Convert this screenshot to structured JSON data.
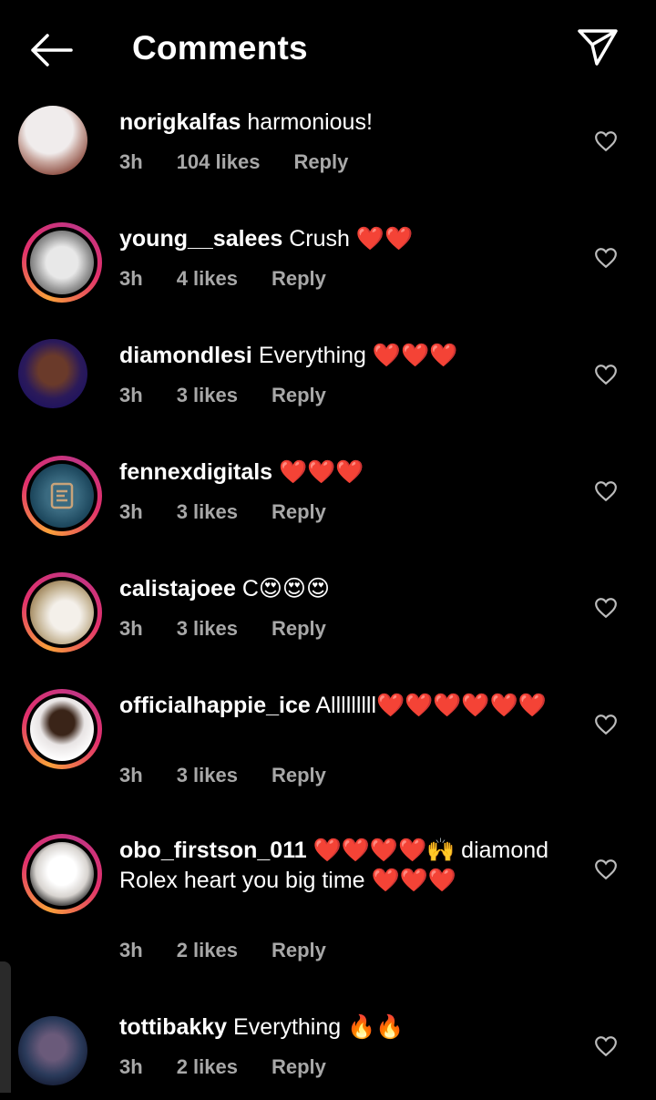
{
  "header": {
    "title": "Comments",
    "back_icon": "arrow-left-icon",
    "send_icon": "paper-plane-icon"
  },
  "comments": [
    {
      "username": "norigkalfas",
      "text": "harmonious!",
      "time": "3h",
      "likes": "104 likes",
      "reply": "Reply"
    },
    {
      "username": "young__salees",
      "text": "Crush ❤️❤️",
      "time": "3h",
      "likes": "4 likes",
      "reply": "Reply"
    },
    {
      "username": "diamondlesi",
      "text": "Everything ❤️❤️❤️",
      "time": "3h",
      "likes": "3 likes",
      "reply": "Reply"
    },
    {
      "username": "fennexdigitals",
      "text": "❤️❤️❤️",
      "time": "3h",
      "likes": "3 likes",
      "reply": "Reply"
    },
    {
      "username": "calistajoee",
      "text": "C😍😍😍",
      "time": "3h",
      "likes": "3 likes",
      "reply": "Reply"
    },
    {
      "username": "officialhappie_ice",
      "text": "Alllllllll❤️❤️❤️❤️❤️❤️",
      "time": "3h",
      "likes": "3 likes",
      "reply": "Reply"
    },
    {
      "username": "obo_firstson_011",
      "text": "❤️❤️❤️❤️🙌 diamond Rolex heart you big time ❤️❤️❤️",
      "time": "3h",
      "likes": "2 likes",
      "reply": "Reply"
    },
    {
      "username": "tottibakky",
      "text": "Everything 🔥🔥",
      "time": "3h",
      "likes": "2 likes",
      "reply": "Reply"
    }
  ]
}
